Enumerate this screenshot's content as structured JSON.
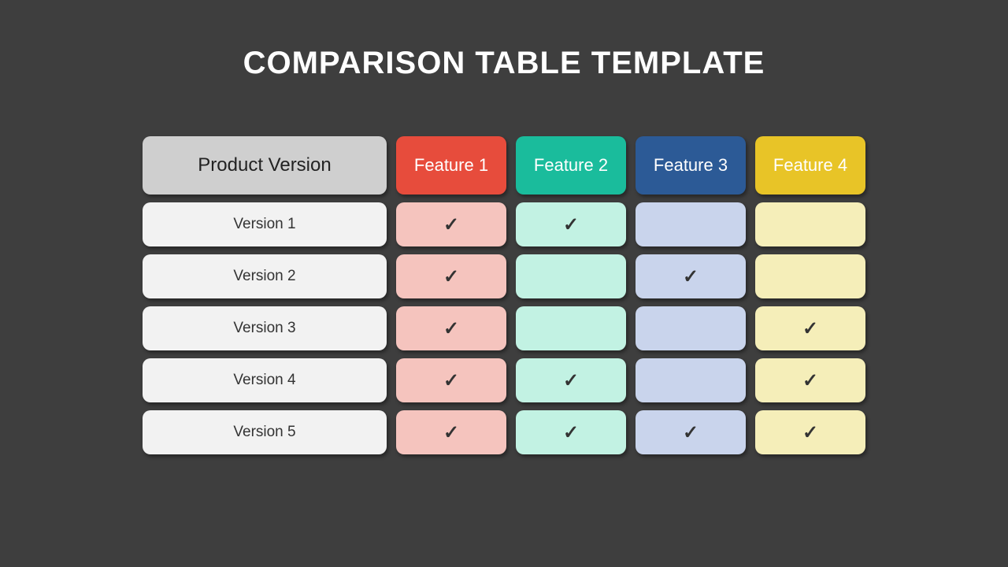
{
  "title": "COMPARISON TABLE TEMPLATE",
  "headers": {
    "main": "Product Version",
    "f1": "Feature 1",
    "f2": "Feature 2",
    "f3": "Feature 3",
    "f4": "Feature 4"
  },
  "rows": [
    {
      "label": "Version 1",
      "f1": true,
      "f2": true,
      "f3": false,
      "f4": false
    },
    {
      "label": "Version 2",
      "f1": true,
      "f2": false,
      "f3": true,
      "f4": false
    },
    {
      "label": "Version 3",
      "f1": true,
      "f2": false,
      "f3": false,
      "f4": true
    },
    {
      "label": "Version 4",
      "f1": true,
      "f2": true,
      "f3": false,
      "f4": true
    },
    {
      "label": "Version 5",
      "f1": true,
      "f2": true,
      "f3": true,
      "f4": true
    }
  ],
  "checkmark": "✓"
}
